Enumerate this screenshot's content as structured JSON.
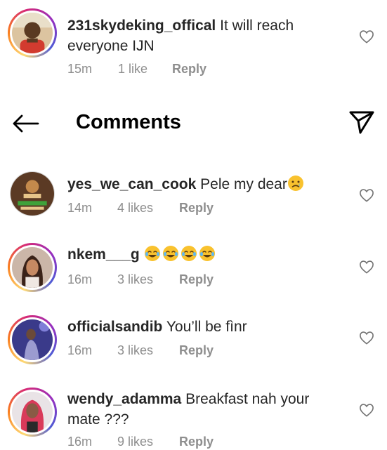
{
  "header": {
    "title": "Comments"
  },
  "pinned_comment": {
    "username": "231skydeking_offical",
    "text": " It will reach everyone IJN",
    "time": "15m",
    "likes": "1 like",
    "reply": "Reply"
  },
  "comments": [
    {
      "username": "yes_we_can_cook",
      "text": " Pele my dear",
      "emoji": "sad-face-emoji",
      "time": "14m",
      "likes": "4 likes",
      "reply": "Reply"
    },
    {
      "username": "nkem___g",
      "text": " ",
      "emoji": "tears-of-joy-emoji",
      "time": "16m",
      "likes": "3 likes",
      "reply": "Reply"
    },
    {
      "username": "officialsandib",
      "text": " You’ll be fìnr",
      "time": "16m",
      "likes": "3 likes",
      "reply": "Reply"
    },
    {
      "username": "wendy_adamma",
      "text": " Breakfast nah your mate ???",
      "time": "16m",
      "likes": "9 likes",
      "reply": "Reply"
    }
  ],
  "icons": {
    "back": "back-arrow-icon",
    "send": "send-icon",
    "like": "heart-icon"
  },
  "colors": {
    "text": "#262626",
    "meta": "#8e8e8e",
    "ring_start": "#feda75",
    "ring_mid": "#d62976",
    "ring_end": "#4f5bd5"
  }
}
